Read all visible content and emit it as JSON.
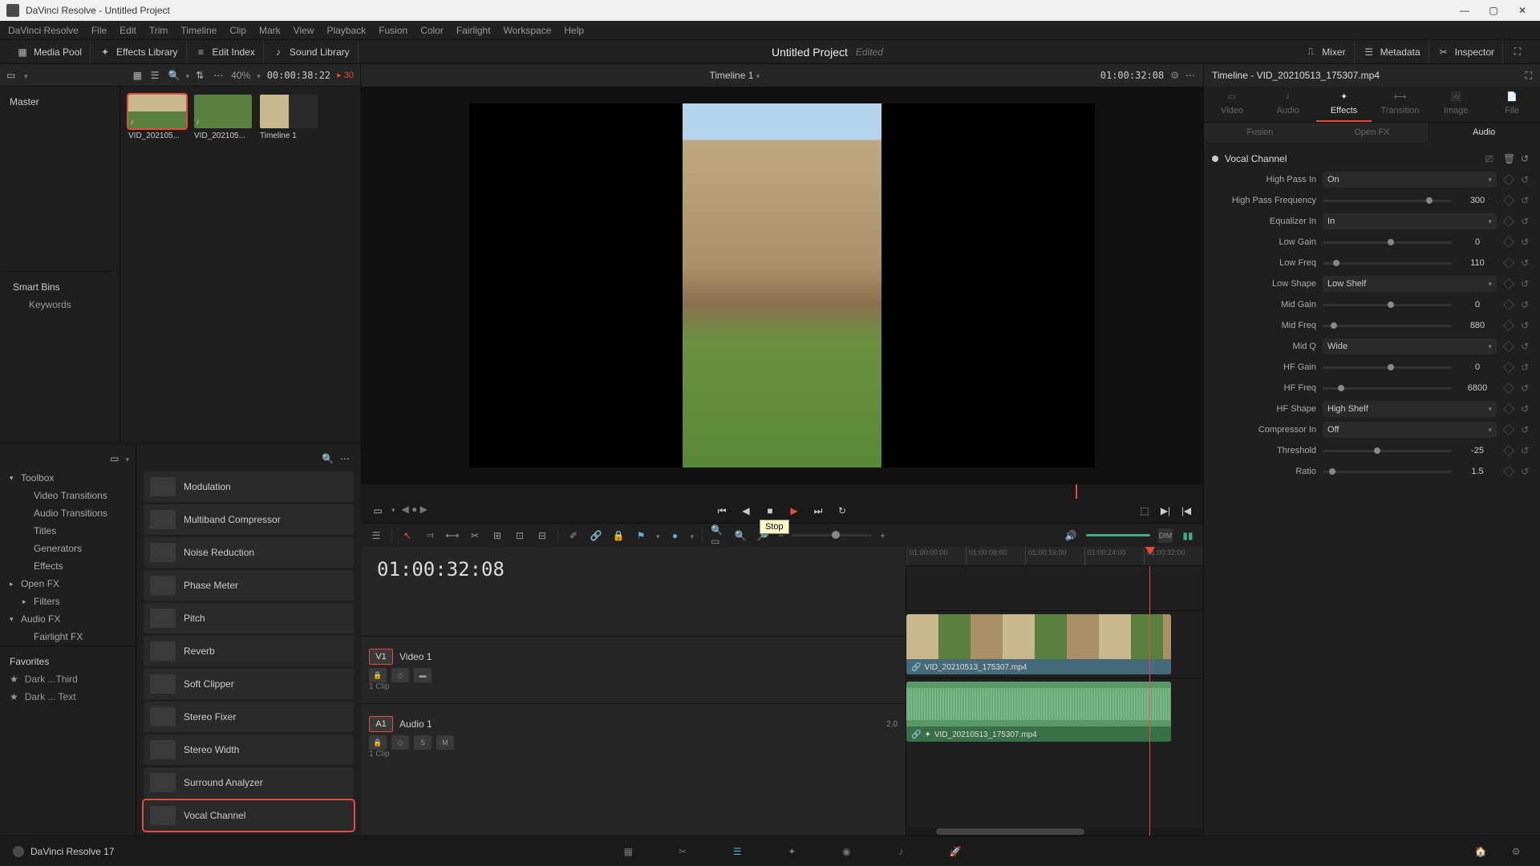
{
  "titlebar": {
    "text": "DaVinci Resolve - Untitled Project"
  },
  "menu": [
    "DaVinci Resolve",
    "File",
    "Edit",
    "Trim",
    "Timeline",
    "Clip",
    "Mark",
    "View",
    "Playback",
    "Fusion",
    "Color",
    "Fairlight",
    "Workspace",
    "Help"
  ],
  "top_toolbar": {
    "media_pool": "Media Pool",
    "effects_library": "Effects Library",
    "edit_index": "Edit Index",
    "sound_library": "Sound Library",
    "mixer": "Mixer",
    "metadata": "Metadata",
    "inspector": "Inspector"
  },
  "project": {
    "title": "Untitled Project",
    "status": "Edited"
  },
  "media_header": {
    "zoom": "40%",
    "tc": "00:00:38:22",
    "fps": "30"
  },
  "master": "Master",
  "thumbs": [
    {
      "label": "VID_202105...",
      "kind": "field",
      "selected": true
    },
    {
      "label": "VID_202105...",
      "kind": "green",
      "selected": false
    },
    {
      "label": "Timeline 1",
      "kind": "timeline",
      "selected": false
    }
  ],
  "smart_bins": {
    "title": "Smart Bins",
    "items": [
      "Keywords"
    ]
  },
  "fx_tree": [
    {
      "label": "Toolbox",
      "caret": "▾",
      "indent": 0
    },
    {
      "label": "Video Transitions",
      "caret": "",
      "indent": 1
    },
    {
      "label": "Audio Transitions",
      "caret": "",
      "indent": 1
    },
    {
      "label": "Titles",
      "caret": "",
      "indent": 1
    },
    {
      "label": "Generators",
      "caret": "",
      "indent": 1
    },
    {
      "label": "Effects",
      "caret": "",
      "indent": 1
    },
    {
      "label": "Open FX",
      "caret": "▸",
      "indent": 0
    },
    {
      "label": "Filters",
      "caret": "▸",
      "indent": 1
    },
    {
      "label": "Audio FX",
      "caret": "▾",
      "indent": 0
    },
    {
      "label": "Fairlight FX",
      "caret": "",
      "indent": 1
    }
  ],
  "fx_list": [
    "Modulation",
    "Multiband Compressor",
    "Noise Reduction",
    "Phase Meter",
    "Pitch",
    "Reverb",
    "Soft Clipper",
    "Stereo Fixer",
    "Stereo Width",
    "Surround Analyzer",
    "Vocal Channel"
  ],
  "fx_selected": "Vocal Channel",
  "favorites": {
    "title": "Favorites",
    "items": [
      "Dark ...Third",
      "Dark ... Text"
    ]
  },
  "viewer": {
    "timeline_name": "Timeline 1",
    "tc_right": "01:00:32:08",
    "tooltip": "Stop"
  },
  "timeline": {
    "tc": "01:00:32:08",
    "ruler": [
      "01:00:00:00",
      "01:00:08:00",
      "01:00:16:00",
      "01:00:24:00",
      "01:00:32:00"
    ],
    "video_track": {
      "badge": "V1",
      "name": "Video 1",
      "clips": "1 Clip"
    },
    "audio_track": {
      "badge": "A1",
      "name": "Audio 1",
      "clips": "1 Clip",
      "ch": "2.0"
    },
    "video_clip_name": "VID_20210513_175307.mp4",
    "audio_clip_name": "VID_20210513_175307.mp4"
  },
  "inspector": {
    "title": "Timeline - VID_20210513_175307.mp4",
    "tabs": [
      "Video",
      "Audio",
      "Effects",
      "Transition",
      "Image",
      "File"
    ],
    "active_tab": "Effects",
    "subtabs": [
      "Fusion",
      "Open FX",
      "Audio"
    ],
    "active_subtab": "Audio",
    "fx_name": "Vocal Channel",
    "params": [
      {
        "label": "High Pass In",
        "type": "select",
        "value": "On"
      },
      {
        "label": "High Pass Frequency",
        "type": "slider",
        "value": "300",
        "pos": 80
      },
      {
        "label": "Equalizer In",
        "type": "select",
        "value": "In"
      },
      {
        "label": "Low Gain",
        "type": "slider",
        "value": "0",
        "pos": 50
      },
      {
        "label": "Low Freq",
        "type": "slider",
        "value": "110",
        "pos": 8
      },
      {
        "label": "Low Shape",
        "type": "select",
        "value": "Low Shelf"
      },
      {
        "label": "Mid Gain",
        "type": "slider",
        "value": "0",
        "pos": 50
      },
      {
        "label": "Mid Freq",
        "type": "slider",
        "value": "880",
        "pos": 6
      },
      {
        "label": "Mid Q",
        "type": "select",
        "value": "Wide"
      },
      {
        "label": "HF Gain",
        "type": "slider",
        "value": "0",
        "pos": 50
      },
      {
        "label": "HF Freq",
        "type": "slider",
        "value": "6800",
        "pos": 12
      },
      {
        "label": "HF Shape",
        "type": "select",
        "value": "High Shelf"
      },
      {
        "label": "Compressor In",
        "type": "select",
        "value": "Off"
      },
      {
        "label": "Threshold",
        "type": "slider",
        "value": "-25",
        "pos": 40
      },
      {
        "label": "Ratio",
        "type": "slider",
        "value": "1.5",
        "pos": 5
      }
    ]
  },
  "bottombar": {
    "label": "DaVinci Resolve 17"
  }
}
